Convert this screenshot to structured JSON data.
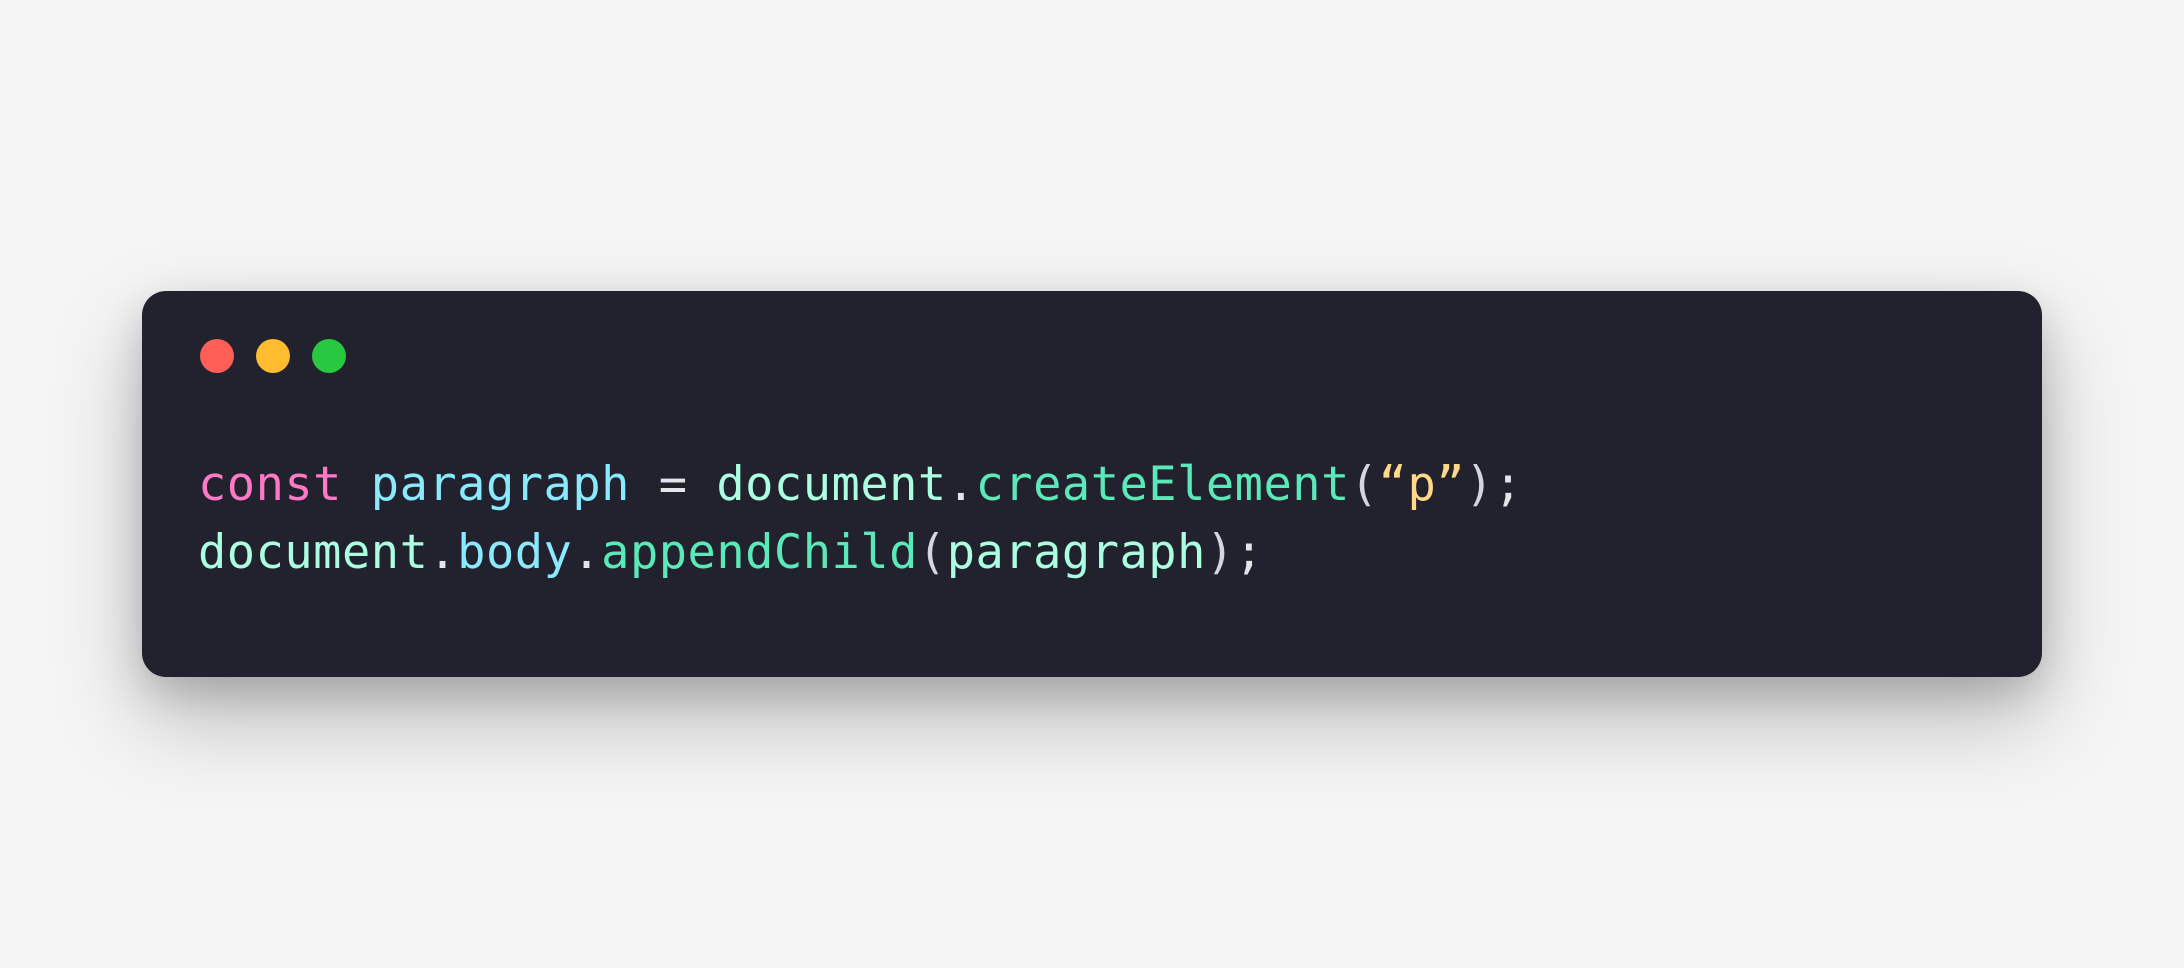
{
  "code": {
    "line1": {
      "t1_keyword": "const",
      "t2_space": " ",
      "t3_var": "paragraph",
      "t4_space": " ",
      "t5_equals": "=",
      "t6_space": " ",
      "t7_obj": "document",
      "t8_dot": ".",
      "t9_method": "createElement",
      "t10_lparen": "(",
      "t11_string": "“p”",
      "t12_rparen": ")",
      "t13_semi": ";"
    },
    "line2": {
      "t1_obj": "document",
      "t2_dot": ".",
      "t3_prop": "body",
      "t4_dot": ".",
      "t5_method": "appendChild",
      "t6_lparen": "(",
      "t7_arg": "paragraph",
      "t8_rparen": ")",
      "t9_semi": ";"
    }
  }
}
